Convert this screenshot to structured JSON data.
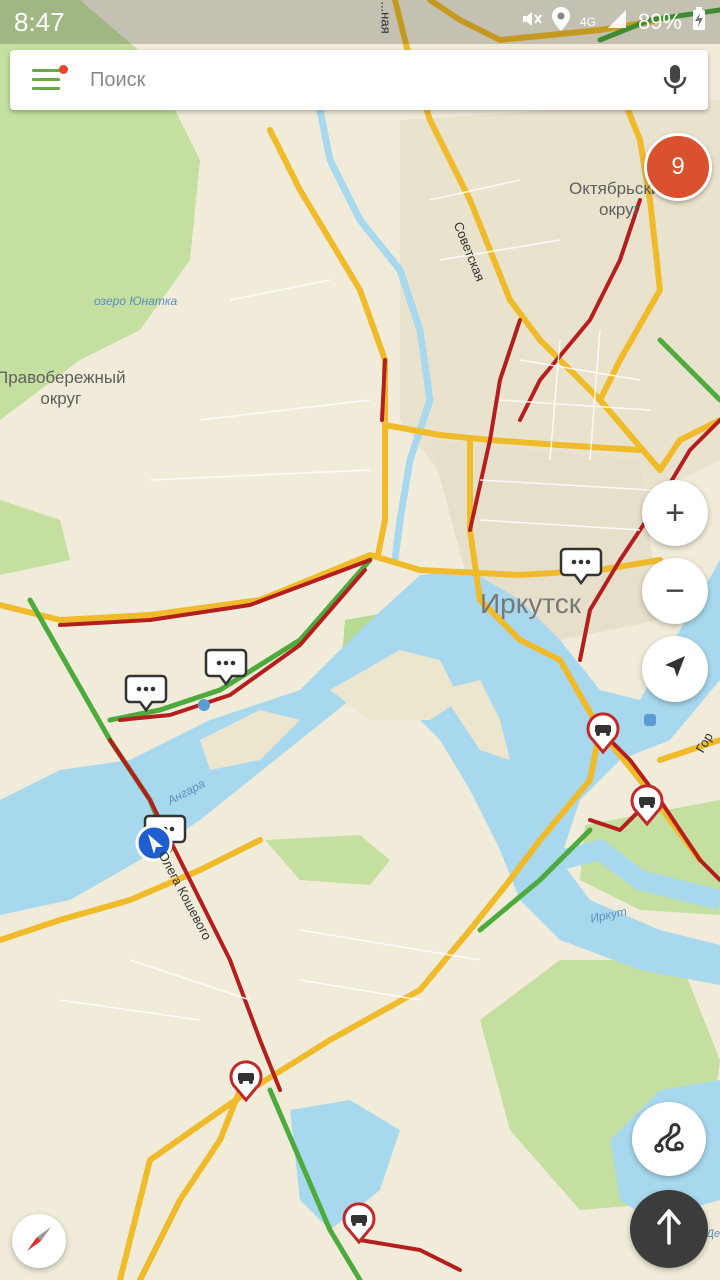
{
  "status_bar": {
    "time": "8:47",
    "network": "4G",
    "battery": "89%"
  },
  "search": {
    "placeholder": "Поиск"
  },
  "traffic_level": "9",
  "labels": {
    "oktyabrsky": "Октябрьский\nокруг",
    "pravoberezhny": "Правобережный\nокруг",
    "lake": "озеро Юнатка",
    "irkutsk": "Иркутск",
    "angara": "Ангара",
    "irkut": "Иркут",
    "sovetskaya": "Советская",
    "koshevogo": "Олега Кошевого",
    "top_street": "...ная",
    "gorky": "Гор",
    "island": "о. Де"
  },
  "controls": {
    "zoom_in": "+",
    "zoom_out": "−",
    "locate": "location-arrow-icon",
    "routes": "route-icon",
    "compass": "compass-icon",
    "go": "arrow-up-icon"
  },
  "colors": {
    "land": "#f1ecd9",
    "water": "#a8d8ee",
    "park": "#c4dfa0",
    "road_free": "#4daa3d",
    "road_slow": "#f0bb2a",
    "road_jam": "#b51e1e",
    "accent": "#6aa842",
    "traffic_badge": "#d9512f"
  }
}
